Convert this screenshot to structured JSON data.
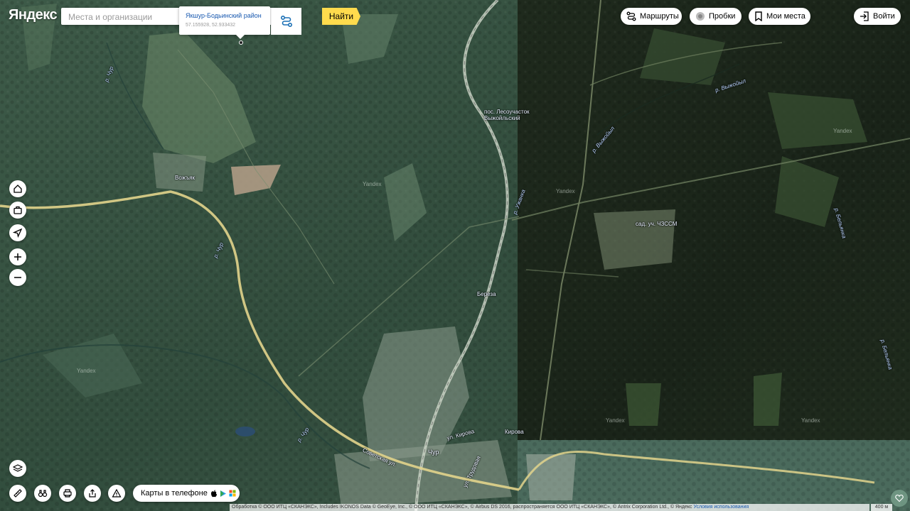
{
  "header": {
    "logo": "Яндекс",
    "search_placeholder": "Места и организации",
    "find_label": "Найти",
    "suggest": {
      "title": "Якшур-Бодьинский район",
      "coords": "57.155928, 52.933432"
    },
    "routes_label": "Маршруты",
    "traffic_label": "Пробки",
    "my_places_label": "Мои места",
    "login_label": "Войти"
  },
  "map_labels": {
    "river_chur_1": "р. Чур",
    "river_chur_2": "р. Чур",
    "river_chur_3": "р. Чур",
    "river_vyzhoyl_1": "р. Выжойыл",
    "river_vyzhoyl_2": "р. Выжойыл",
    "river_uzhanka": "р. Ужанка",
    "river_belyanka_1": "р. Бельянка",
    "river_belyanka_2": "р. Бельянка",
    "village_vozhyak": "Вожъяк",
    "village_bereza": "Береза",
    "village_chur": "Чур",
    "settlement": "пос. Лесоучасток Выжойльский",
    "garden": "сад. уч. ЧЗССМ",
    "street_sovetskaya": "Советская ул.",
    "street_kirova_1": "ул. Кирова",
    "street_kirova_2": "Кирова",
    "street_4": "ул. Трудовая",
    "watermark": "Yandex"
  },
  "controls": {
    "app_promo": "Карты в телефоне"
  },
  "footer": {
    "copyright": "Обработка © ООО ИТЦ «СКАНЭКС», Includes IKONOS Data © GeoEye, Inc., © ООО ИТЦ «СКАНЭКС», © Airbus DS 2016, распространяется ООО ИТЦ «СКАНЭКС», © Antrix Corporation Ltd., © Яндекс",
    "terms": "Условия использования",
    "scale": "400 м"
  },
  "colors": {
    "find_button": "#ffdb4d",
    "link_blue": "#1a5ab0",
    "forest": "#2f4a38"
  }
}
